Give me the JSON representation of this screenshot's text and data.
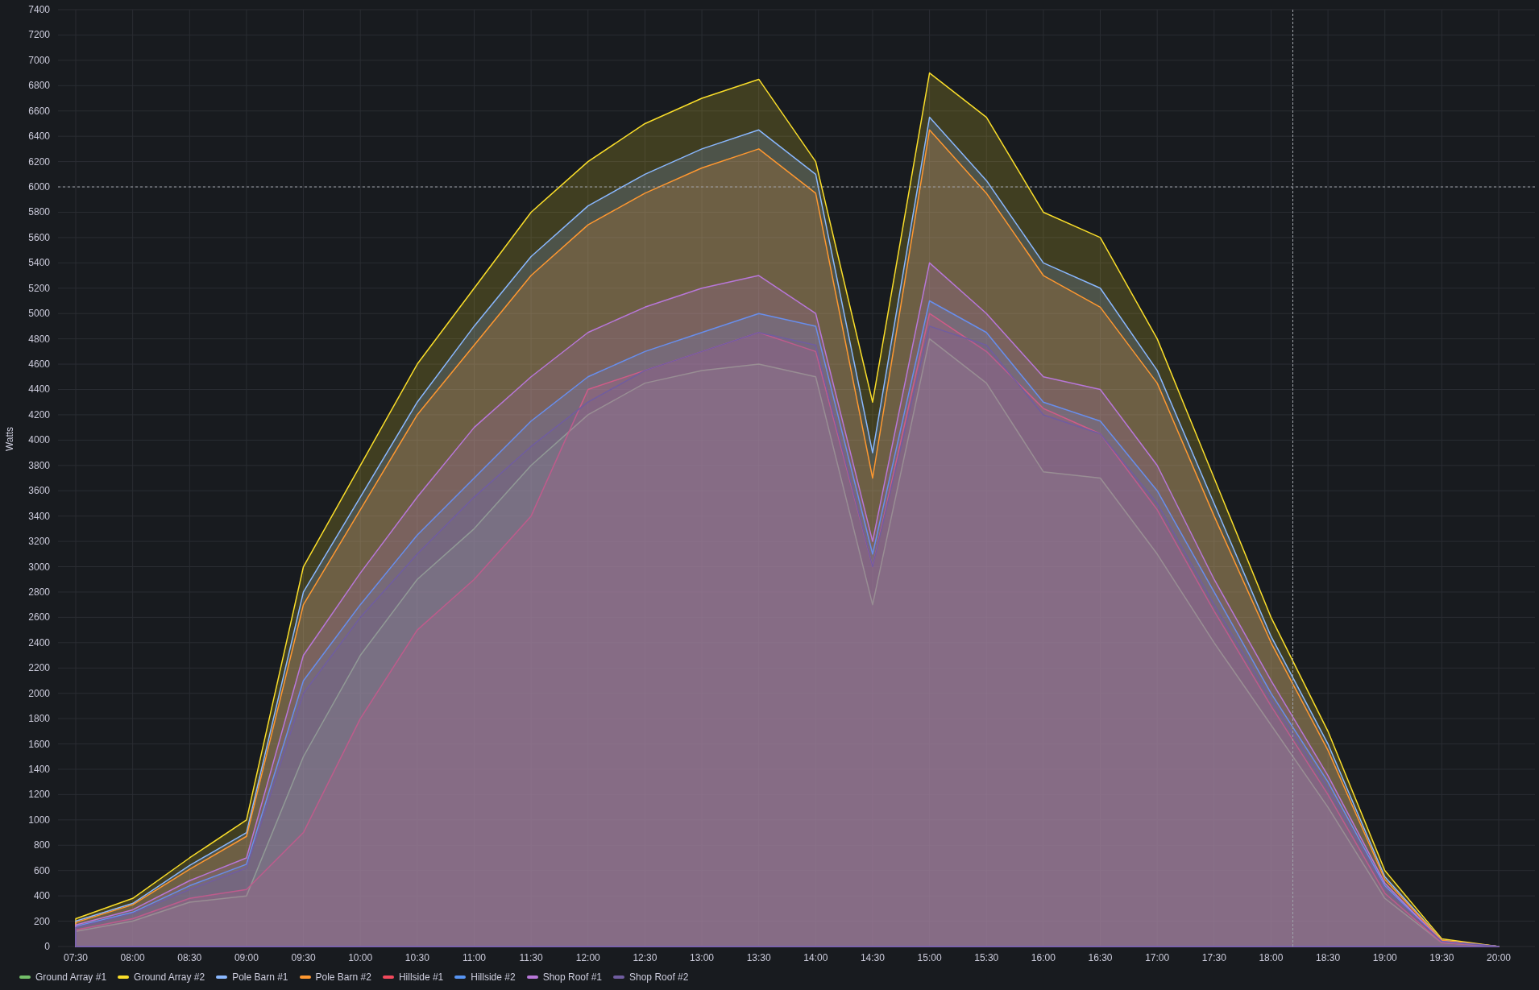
{
  "chart": {
    "chart_data": {
      "type": "area",
      "ylabel": "Watts",
      "stacked": false,
      "grid": true,
      "ref_lines": [
        {
          "axis": "y",
          "value": 6000
        }
      ],
      "categories": [
        "07:30",
        "08:00",
        "08:30",
        "09:00",
        "09:30",
        "10:00",
        "10:30",
        "11:00",
        "11:30",
        "12:00",
        "12:30",
        "13:00",
        "13:30",
        "14:00",
        "14:30",
        "15:00",
        "15:30",
        "16:00",
        "16:30",
        "17:00",
        "17:30",
        "18:00",
        "18:30",
        "19:00",
        "19:30",
        "20:00"
      ],
      "ylim": [
        0,
        7400
      ],
      "yticks": [
        0,
        200,
        400,
        600,
        800,
        1000,
        1200,
        1400,
        1600,
        1800,
        2000,
        2200,
        2400,
        2600,
        2800,
        3000,
        3200,
        3400,
        3600,
        3800,
        4000,
        4200,
        4400,
        4600,
        4800,
        5000,
        5200,
        5400,
        5600,
        5800,
        6000,
        6200,
        6400,
        6600,
        6800,
        7000,
        7200,
        7400
      ],
      "series": [
        {
          "name": "Ground Array #1",
          "color": "#73bf69",
          "values": [
            120,
            200,
            350,
            400,
            1500,
            2300,
            2900,
            3300,
            3800,
            4200,
            4450,
            4550,
            4600,
            4500,
            2700,
            4800,
            4450,
            3750,
            3700,
            3100,
            2400,
            1750,
            1100,
            380,
            30,
            0
          ]
        },
        {
          "name": "Ground Array #2",
          "color": "#fade2a",
          "values": [
            220,
            380,
            700,
            1000,
            3000,
            3800,
            4600,
            5200,
            5800,
            6200,
            6500,
            6700,
            6850,
            6200,
            4300,
            6900,
            6550,
            5800,
            5600,
            4800,
            3700,
            2600,
            1700,
            600,
            60,
            0
          ]
        },
        {
          "name": "Pole Barn #1",
          "color": "#8ab8ff",
          "values": [
            200,
            340,
            640,
            900,
            2800,
            3550,
            4300,
            4900,
            5450,
            5850,
            6100,
            6300,
            6450,
            6100,
            3900,
            6550,
            6050,
            5400,
            5200,
            4550,
            3500,
            2450,
            1600,
            550,
            50,
            0
          ]
        },
        {
          "name": "Pole Barn #2",
          "color": "#ff9830",
          "values": [
            190,
            330,
            610,
            870,
            2700,
            3450,
            4200,
            4750,
            5300,
            5700,
            5950,
            6150,
            6300,
            5950,
            3700,
            6450,
            5950,
            5300,
            5050,
            4450,
            3400,
            2400,
            1550,
            530,
            50,
            0
          ]
        },
        {
          "name": "Hillside #1",
          "color": "#f2495c",
          "values": [
            130,
            220,
            380,
            450,
            900,
            1800,
            2500,
            2900,
            3400,
            4400,
            4550,
            4700,
            4850,
            4700,
            3000,
            5000,
            4700,
            4250,
            4050,
            3450,
            2650,
            1900,
            1200,
            420,
            30,
            0
          ]
        },
        {
          "name": "Hillside #2",
          "color": "#5794f2",
          "values": [
            160,
            270,
            480,
            650,
            2100,
            2700,
            3250,
            3700,
            4150,
            4500,
            4700,
            4850,
            5000,
            4900,
            3100,
            5100,
            4850,
            4300,
            4150,
            3600,
            2800,
            2000,
            1300,
            480,
            40,
            0
          ]
        },
        {
          "name": "Shop Roof #1",
          "color": "#b877d9",
          "values": [
            170,
            290,
            520,
            700,
            2300,
            2950,
            3550,
            4100,
            4500,
            4850,
            5050,
            5200,
            5300,
            5000,
            3200,
            5400,
            5000,
            4500,
            4400,
            3800,
            2900,
            2100,
            1350,
            500,
            40,
            0
          ]
        },
        {
          "name": "Shop Roof #2",
          "color": "#705da0",
          "values": [
            150,
            260,
            450,
            620,
            2000,
            2600,
            3100,
            3550,
            3950,
            4300,
            4550,
            4700,
            4850,
            4750,
            3000,
            4900,
            4750,
            4200,
            4050,
            3500,
            2700,
            1950,
            1250,
            460,
            40,
            0
          ]
        }
      ]
    }
  }
}
